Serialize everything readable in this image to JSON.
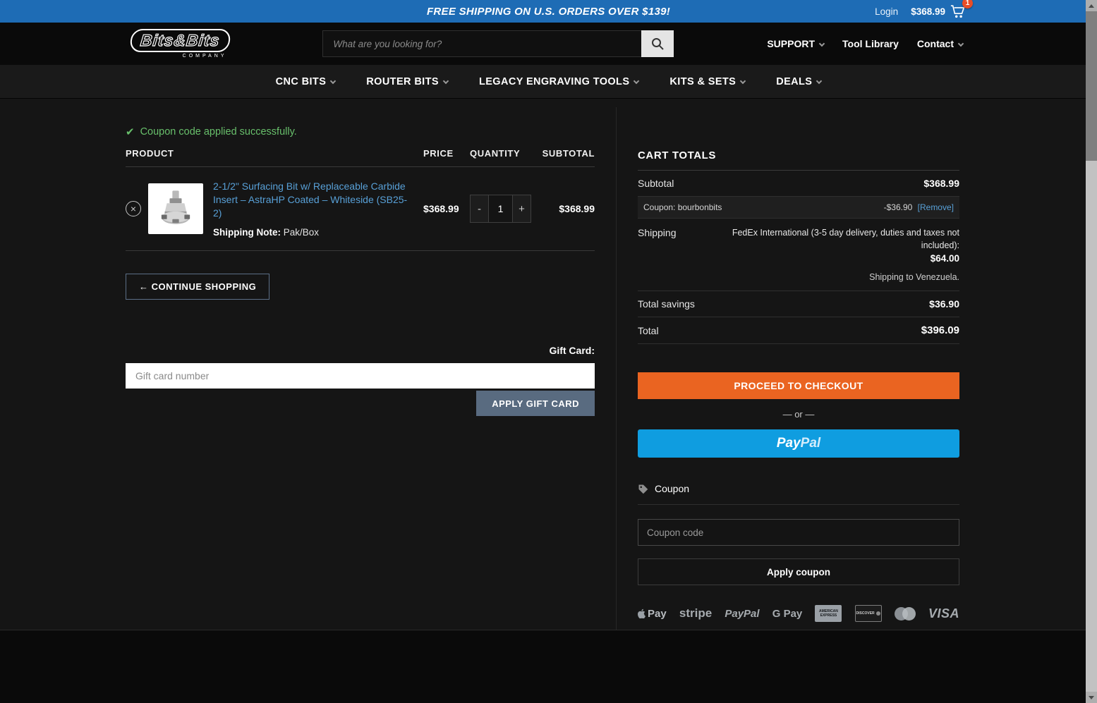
{
  "topbar": {
    "promo": "FREE SHIPPING ON U.S. ORDERS OVER $139!",
    "login": "Login",
    "cart_total": "$368.99",
    "cart_count": "1"
  },
  "header": {
    "logo": "Bits&Bits",
    "logo_sub": "COMPANY",
    "search_placeholder": "What are you looking for?",
    "links": [
      {
        "label": "SUPPORT"
      },
      {
        "label": "Tool Library"
      },
      {
        "label": "Contact"
      }
    ]
  },
  "nav": {
    "items": [
      {
        "label": "CNC BITS"
      },
      {
        "label": "ROUTER BITS"
      },
      {
        "label": "LEGACY ENGRAVING TOOLS"
      },
      {
        "label": "KITS & SETS"
      },
      {
        "label": "DEALS"
      }
    ]
  },
  "notice": {
    "icon": "✔",
    "text": "Coupon code applied successfully."
  },
  "cart_table": {
    "headers": {
      "product": "PRODUCT",
      "price": "PRICE",
      "quantity": "QUANTITY",
      "subtotal": "SUBTOTAL"
    },
    "item": {
      "remove_glyph": "×",
      "title": "2-1/2\" Surfacing Bit w/ Replaceable Carbide Insert – AstraHP Coated – Whiteside (SB25-2)",
      "shipping_note_label": "Shipping Note:",
      "shipping_note_value": "Pak/Box",
      "price": "$368.99",
      "qty_minus": "-",
      "qty_value": "1",
      "qty_plus": "+",
      "subtotal": "$368.99"
    },
    "continue_shopping": "← CONTINUE SHOPPING"
  },
  "gift_card": {
    "label": "Gift Card:",
    "placeholder": "Gift card number",
    "apply_button": "APPLY GIFT CARD"
  },
  "cart_totals": {
    "heading": "CART TOTALS",
    "subtotal": {
      "label": "Subtotal",
      "value": "$368.99"
    },
    "coupon": {
      "label": "Coupon: bourbonbits",
      "value": "-$36.90",
      "remove": "[Remove]"
    },
    "shipping": {
      "label": "Shipping",
      "method": "FedEx International (3-5 day delivery, duties and taxes not included):",
      "cost": "$64.00",
      "destination": "Shipping to Venezuela."
    },
    "savings": {
      "label": "Total savings",
      "value": "$36.90"
    },
    "total": {
      "label": "Total",
      "value": "$396.09"
    },
    "checkout_button": "PROCEED TO CHECKOUT",
    "or_divider": "— or —",
    "paypal_button_1": "Pay",
    "paypal_button_2": "Pal",
    "coupon_section": {
      "heading": "Coupon",
      "placeholder": "Coupon code",
      "apply_button": "Apply coupon"
    }
  },
  "payments": {
    "applepay": "Pay",
    "stripe": "stripe",
    "paypal": "PayPal",
    "gpay": "G Pay",
    "amex": "AMERICAN EXPRESS",
    "discover": "DISCOVER",
    "visa": "VISA"
  },
  "colors": {
    "topbar_blue": "#1e6cb5",
    "accent_orange": "#ea6421",
    "paypal_blue": "#0f9de0",
    "success_green": "#68bf6b",
    "link_blue": "#58a0d7"
  }
}
